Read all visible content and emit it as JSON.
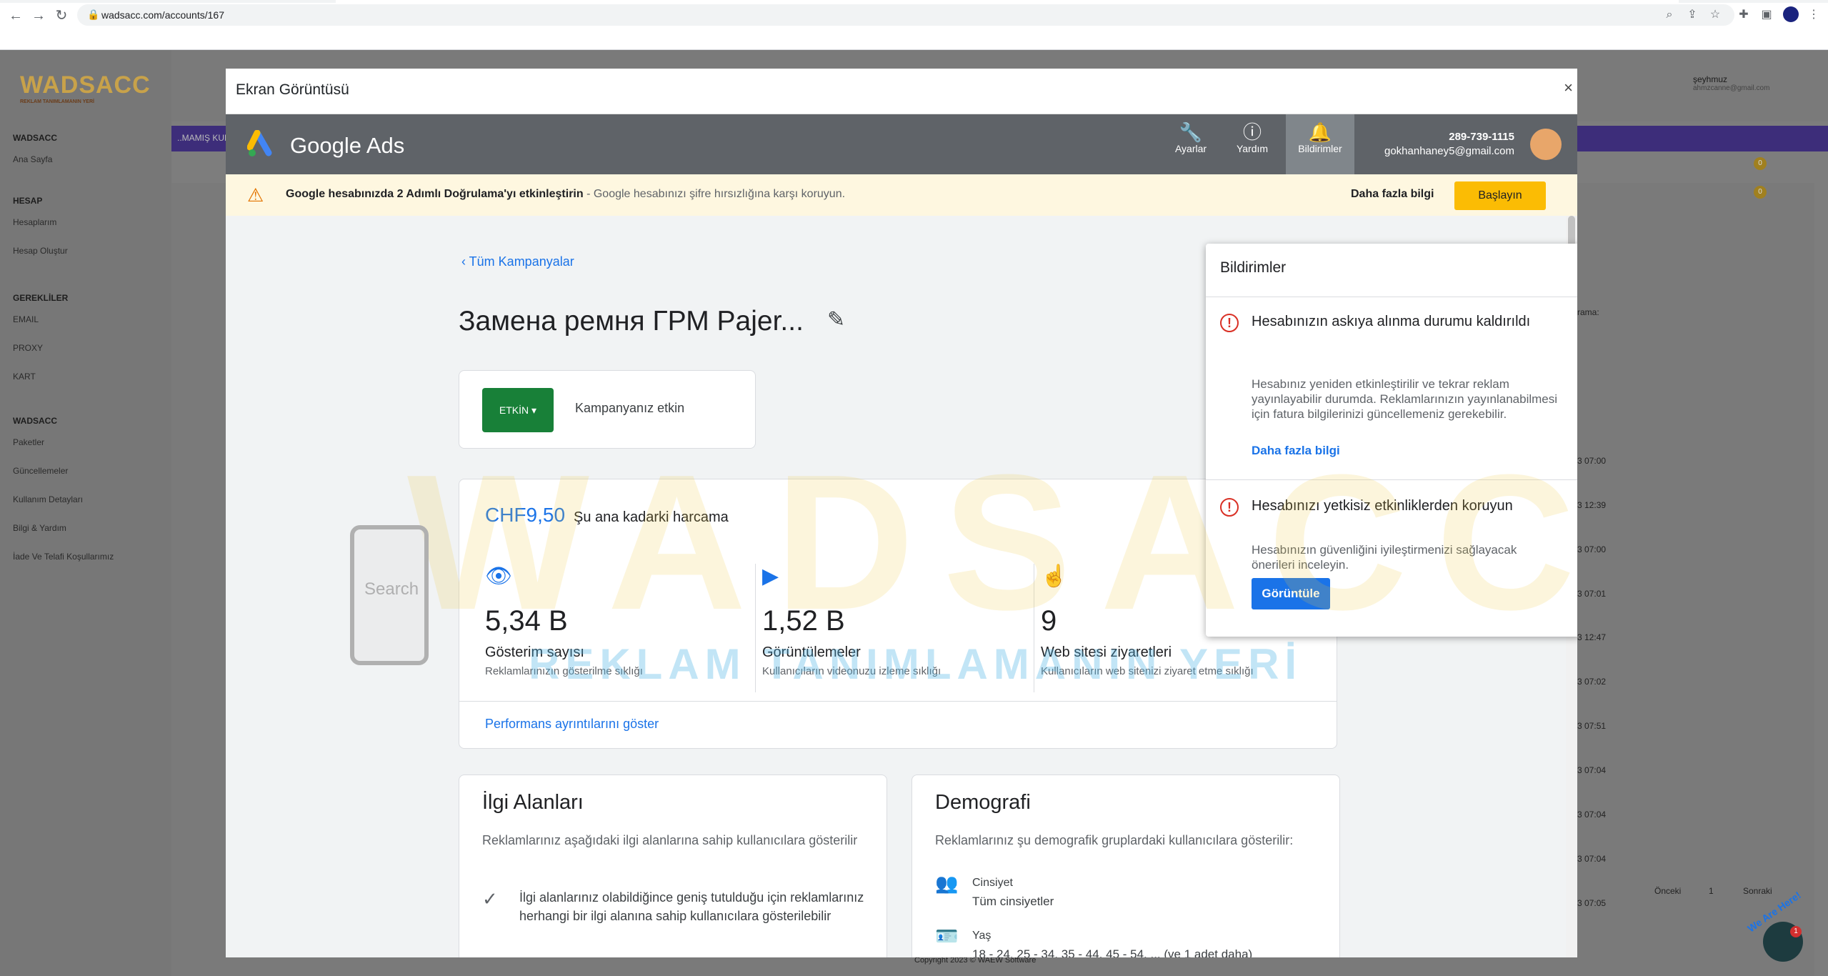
{
  "browser": {
    "url": "wadsacc.com/accounts/167"
  },
  "site": {
    "logo": "WADSACC",
    "logo_tag": "REKLAM TANIMLAMANIN YERİ",
    "user_name": "şeyhmuz",
    "user_email": "ahmzcanne@gmail.com",
    "purple_text": "..MAMIŞ KUR"
  },
  "sidebar": {
    "sec1": "WADSACC",
    "home": "Ana Sayfa",
    "sec2": "HESAP",
    "accounts": "Hesaplarım",
    "create": "Hesap Oluştur",
    "sec3": "GEREKLİLER",
    "email": "EMAIL",
    "proxy": "PROXY",
    "kart": "KART",
    "sec4": "WADSACC",
    "packages": "Paketler",
    "updates": "Güncellemeler",
    "usage": "Kullanım Detayları",
    "info": "Bilgi & Yardım",
    "refund": "İade Ve Telafi Koşullarımız"
  },
  "bg_times": [
    "3 07:00",
    "3 12:39",
    "3 07:00",
    "3 07:01",
    "3 12:47",
    "3 07:02",
    "3 07:51",
    "3 07:04",
    "3 07:04",
    "3 07:04",
    "3 07:05"
  ],
  "bg_labels": {
    "search": "Arama:",
    "prev": "Önceki",
    "page": "1",
    "next": "Sonraki",
    "copyright": "Copyright 2023 © WAEW Software"
  },
  "modal": {
    "title": "Ekran Görüntüsü",
    "close": "×"
  },
  "gads": {
    "name": "Google Ads",
    "nav": [
      {
        "label": "Ayarlar",
        "icon": "wrench-icon"
      },
      {
        "label": "Yardım",
        "icon": "help-icon"
      },
      {
        "label": "Bildirimler",
        "icon": "bell-icon"
      }
    ],
    "phone": "289-739-1115",
    "email": "gokhanhaney5@gmail.com"
  },
  "warning": {
    "bold": "Google hesabınızda 2 Adımlı Doğrulama'yı etkinleştirin",
    "rest": " - Google hesabınızı şifre hırsızlığına karşı koruyun.",
    "more": "Daha fazla bilgi",
    "button": "Başlayın"
  },
  "campaign": {
    "back": "Tüm Kampanyalar",
    "title": "Замена ремня ГРМ Pajer...",
    "status_btn": "ETKİN",
    "status_text": "Kampanyanız etkin"
  },
  "perf": {
    "cost": "CHF9,50",
    "cost_label": "Şu ana kadarki harcama",
    "metrics": [
      {
        "value": "5,34 B",
        "label": "Gösterim sayısı",
        "sub": "Reklamlarınızın gösterilme sıklığı"
      },
      {
        "value": "1,52 B",
        "label": "Görüntülemeler",
        "sub": "Kullanıcıların videonuzu izleme sıklığı"
      },
      {
        "value": "9",
        "label": "Web sitesi ziyaretleri",
        "sub": "Kullanıcıların web sitenizi ziyaret etme sıklığı"
      }
    ],
    "link": "Performans ayrıntılarını göster"
  },
  "interests": {
    "title": "İlgi Alanları",
    "desc": "Reklamlarınız aşağıdaki ilgi alanlarına sahip kullanıcılara gösterilir",
    "item": "İlgi alanlarınız olabildiğince geniş tutulduğu için reklamlarınız herhangi bir ilgi alanına sahip kullanıcılara gösterilebilir"
  },
  "demo": {
    "title": "Demografi",
    "desc": "Reklamlarınız şu demografik gruplardaki kullanıcılara gösterilir:",
    "gender_h": "Cinsiyet",
    "gender_v": "Tüm cinsiyetler",
    "age_h": "Yaş",
    "age_v": "18 - 24, 25 - 34, 35 - 44, 45 - 54, ... (ve 1 adet daha)"
  },
  "notifications": {
    "title": "Bildirimler",
    "items": [
      {
        "title": "Hesabınızın askıya alınma durumu kaldırıldı",
        "body": "Hesabınız yeniden etkinleştirilir ve tekrar reklam yayınlayabilir durumda. Reklamlarınızın yayınlanabilmesi için fatura bilgilerinizi güncellemeniz gerekebilir.",
        "link": "Daha fazla bilgi"
      },
      {
        "title": "Hesabınızı yetkisiz etkinliklerden koruyun",
        "body": "Hesabınızın güvenliğini iyileştirmenizi sağlayacak önerileri inceleyin.",
        "button": "Görüntüle"
      }
    ]
  },
  "overlay": {
    "watermark": "WADSACC",
    "watermark_sub": "REKLAM TANIMLAMANIN YERİ",
    "search_word": "Search",
    "chat_label": "We Are Here!",
    "chat_count": "1"
  },
  "colors": {
    "gads_bar": "#5f6368",
    "accent": "#1a73e8",
    "warning_bg": "#fef7e0",
    "status_green": "#188038"
  }
}
